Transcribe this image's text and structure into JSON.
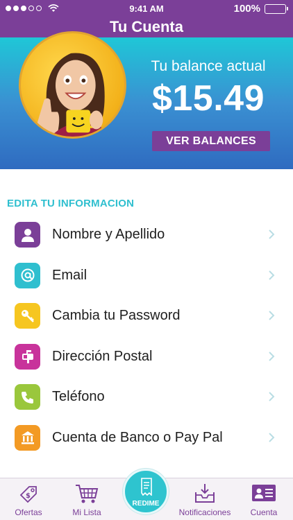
{
  "status_bar": {
    "time": "9:41 AM",
    "battery": "100%",
    "signal_dots": 5,
    "signal_filled": 3
  },
  "header": {
    "title": "Tu Cuenta"
  },
  "balance": {
    "label": "Tu balance actual",
    "amount": "$15.49",
    "button_label": "VER BALANCES"
  },
  "section": {
    "title": "EDITA TU INFORMACION"
  },
  "menu": {
    "items": [
      {
        "label": "Nombre y Apellido",
        "icon": "user-icon",
        "color": "#7b3f98"
      },
      {
        "label": "Email",
        "icon": "at-sign-icon",
        "color": "#2fbfcf"
      },
      {
        "label": "Cambia tu Password",
        "icon": "key-icon",
        "color": "#f6c620"
      },
      {
        "label": "Dirección Postal",
        "icon": "mailbox-icon",
        "color": "#c8339b"
      },
      {
        "label": "Teléfono",
        "icon": "phone-icon",
        "color": "#9ac73c"
      },
      {
        "label": "Cuenta de Banco o Pay Pal",
        "icon": "bank-icon",
        "color": "#f39a24"
      }
    ]
  },
  "tabs": {
    "ofertas": "Ofertas",
    "mi_lista": "Mi Lista",
    "redime": "REDIME",
    "notificaciones": "Notificaciones",
    "cuenta": "Cuenta"
  },
  "colors": {
    "brand_purple": "#7b3f98",
    "accent_teal": "#2fbfcf",
    "chevron": "#b9dde4"
  }
}
